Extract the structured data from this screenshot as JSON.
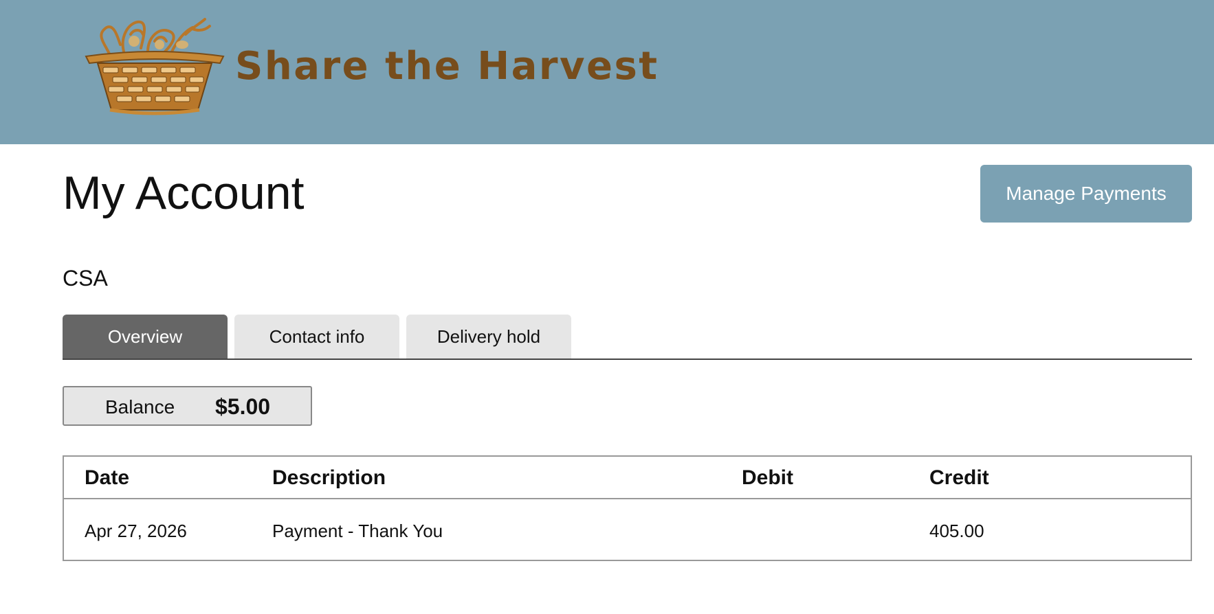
{
  "header": {
    "brand": "Share the Harvest",
    "logo_icon": "basket-icon",
    "background_color": "#7ba1b3",
    "brand_color": "#774d1c"
  },
  "page": {
    "title": "My Account",
    "section": "CSA"
  },
  "actions": {
    "manage_payments": "Manage Payments"
  },
  "tabs": [
    {
      "label": "Overview",
      "active": true
    },
    {
      "label": "Contact info",
      "active": false
    },
    {
      "label": "Delivery hold",
      "active": false
    }
  ],
  "balance": {
    "label": "Balance",
    "value": "$5.00"
  },
  "ledger": {
    "columns": [
      "Date",
      "Description",
      "Debit",
      "Credit"
    ],
    "rows": [
      {
        "date": "Apr 27, 2026",
        "description": "Payment - Thank You",
        "debit": "",
        "credit": "405.00"
      }
    ]
  },
  "colors": {
    "accent": "#7ba1b3",
    "active_tab": "#666666",
    "inactive_tab": "#e6e6e6"
  }
}
